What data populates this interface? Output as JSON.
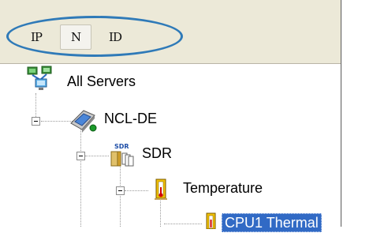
{
  "toolbar": {
    "buttons": [
      {
        "label": "IP"
      },
      {
        "label": "N"
      },
      {
        "label": "ID"
      }
    ]
  },
  "tree": {
    "root": {
      "label": "All Servers",
      "icon": "network-icon"
    },
    "server": {
      "label": "NCL-DE",
      "icon": "server-icon"
    },
    "sdr": {
      "label": "SDR",
      "icon": "sdr-icon",
      "badge": "SDR"
    },
    "temperature": {
      "label": "Temperature",
      "icon": "folder-icon"
    },
    "cpu": {
      "label": "CPU1 Thermal",
      "icon": "folder-icon"
    }
  },
  "colors": {
    "annotation": "#2f7ab8",
    "selection": "#316ac5",
    "toolbar_bg": "#ece9d8"
  }
}
